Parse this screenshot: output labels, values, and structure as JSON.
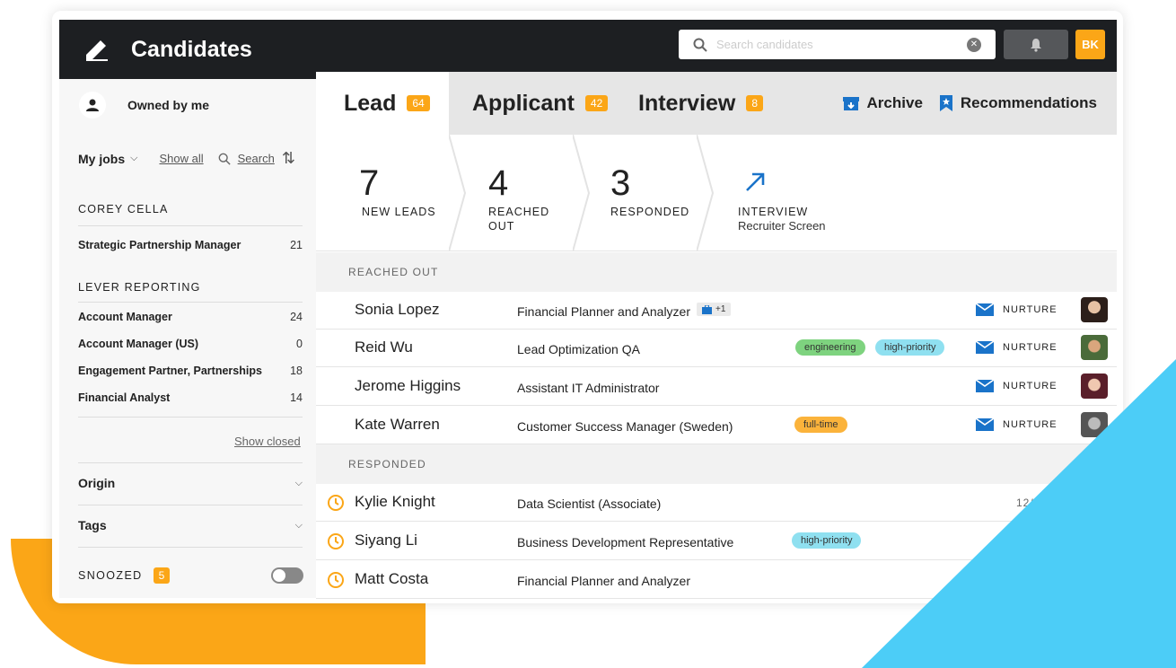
{
  "header": {
    "title": "Candidates",
    "search_placeholder": "Search candidates",
    "user_initials": "BK"
  },
  "sidebar": {
    "owned_label": "Owned by me",
    "myjobs_label": "My jobs",
    "show_all": "Show all",
    "search_label": "Search",
    "sections": [
      {
        "title": "COREY CELLA",
        "jobs": [
          {
            "name": "Strategic Partnership Manager",
            "count": "21"
          }
        ]
      },
      {
        "title": "LEVER REPORTING",
        "jobs": [
          {
            "name": "Account Manager",
            "count": "24"
          },
          {
            "name": "Account Manager (US)",
            "count": "0"
          },
          {
            "name": "Engagement Partner, Partnerships",
            "count": "18"
          },
          {
            "name": "Financial Analyst",
            "count": "14"
          }
        ]
      }
    ],
    "show_closed": "Show closed",
    "filters": [
      {
        "name": "Origin"
      },
      {
        "name": "Tags"
      }
    ],
    "snoozed_label": "SNOOZED",
    "snoozed_count": "5"
  },
  "tabs": [
    {
      "label": "Lead",
      "count": "64"
    },
    {
      "label": "Applicant",
      "count": "42"
    },
    {
      "label": "Interview",
      "count": "8"
    }
  ],
  "actions": {
    "archive": "Archive",
    "recommendations": "Recommendations"
  },
  "funnel": [
    {
      "num": "7",
      "label": "NEW LEADS"
    },
    {
      "num": "4",
      "label": "REACHED",
      "label2": "OUT"
    },
    {
      "num": "3",
      "label": "RESPONDED"
    },
    {
      "label": "INTERVIEW",
      "sub": "Recruiter Screen"
    }
  ],
  "groups": {
    "reached_out": "REACHED OUT",
    "responded": "RESPONDED"
  },
  "reached_rows": [
    {
      "name": "Sonia Lopez",
      "job": "Financial Planner and Analyzer",
      "extra": "+1",
      "nurture": "NURTURE"
    },
    {
      "name": "Reid Wu",
      "job": "Lead Optimization QA",
      "tags": [
        "engineering",
        "high-priority"
      ],
      "nurture": "NURTURE"
    },
    {
      "name": "Jerome Higgins",
      "job": "Assistant IT Administrator",
      "nurture": "NURTURE"
    },
    {
      "name": "Kate Warren",
      "job": "Customer Success Manager (Sweden)",
      "tags": [
        "full-time"
      ],
      "nurture": "NURTURE"
    }
  ],
  "responded_rows": [
    {
      "name": "Kylie Knight",
      "job": "Data Scientist (Associate)",
      "date": "12/"
    },
    {
      "name": "Siyang Li",
      "job": "Business Development Representative",
      "tags": [
        "high-priority"
      ]
    },
    {
      "name": "Matt Costa",
      "job": "Financial Planner and Analyzer"
    }
  ],
  "colors": {
    "accent_orange": "#fba617",
    "accent_blue": "#4ccdf7",
    "header_bg": "#1d1f22",
    "link_blue": "#1a73c9"
  }
}
